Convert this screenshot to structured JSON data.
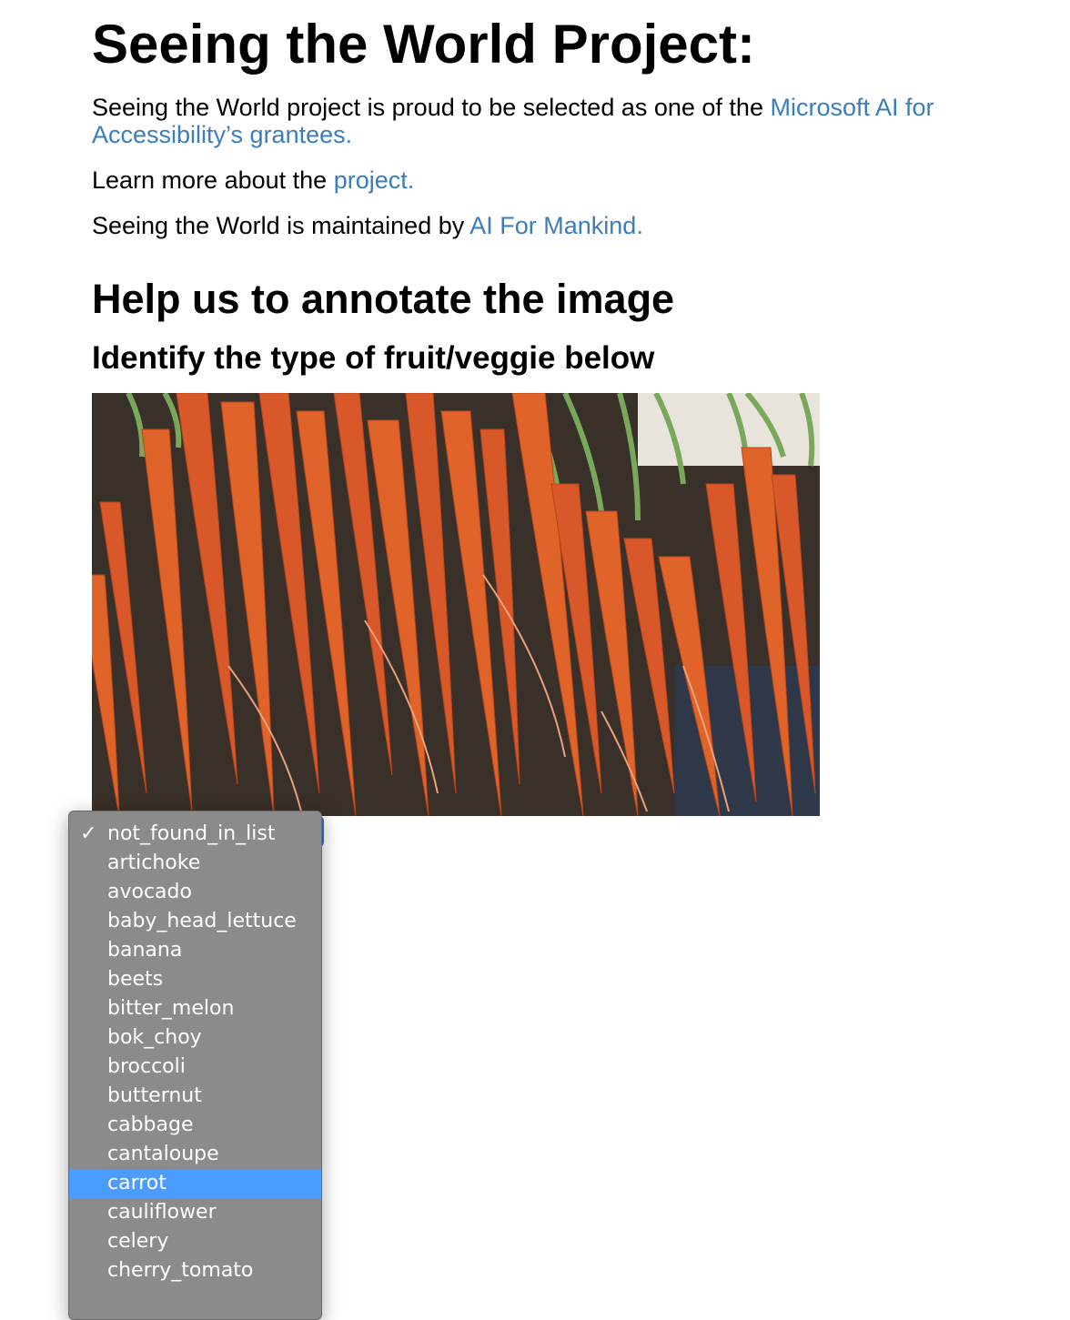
{
  "header": {
    "title": "Seeing the World Project:"
  },
  "intro": {
    "p1_text": "Seeing the World project is proud to be selected as one of the ",
    "p1_link": "Microsoft AI for Accessibility’s grantees.",
    "p2_text": "Learn more about the ",
    "p2_link": "project.",
    "p3_text": "Seeing the World is maintained by ",
    "p3_link": "AI For Mankind."
  },
  "annotate": {
    "heading": "Help us to annotate the image",
    "instruction": "Identify the type of fruit/veggie below"
  },
  "colors": {
    "link": "#3a7dbf",
    "dropdown_bg": "#8b8b8b",
    "highlight": "#4a9cff",
    "carrot": "#e0642a"
  },
  "dropdown": {
    "selected": "not_found_in_list",
    "highlighted": "carrot",
    "check_symbol": "✓",
    "options": [
      "not_found_in_list",
      "artichoke",
      "avocado",
      "baby_head_lettuce",
      "banana",
      "beets",
      "bitter_melon",
      "bok_choy",
      "broccoli",
      "butternut",
      "cabbage",
      "cantaloupe",
      "carrot",
      "cauliflower",
      "celery",
      "cherry_tomato"
    ]
  }
}
